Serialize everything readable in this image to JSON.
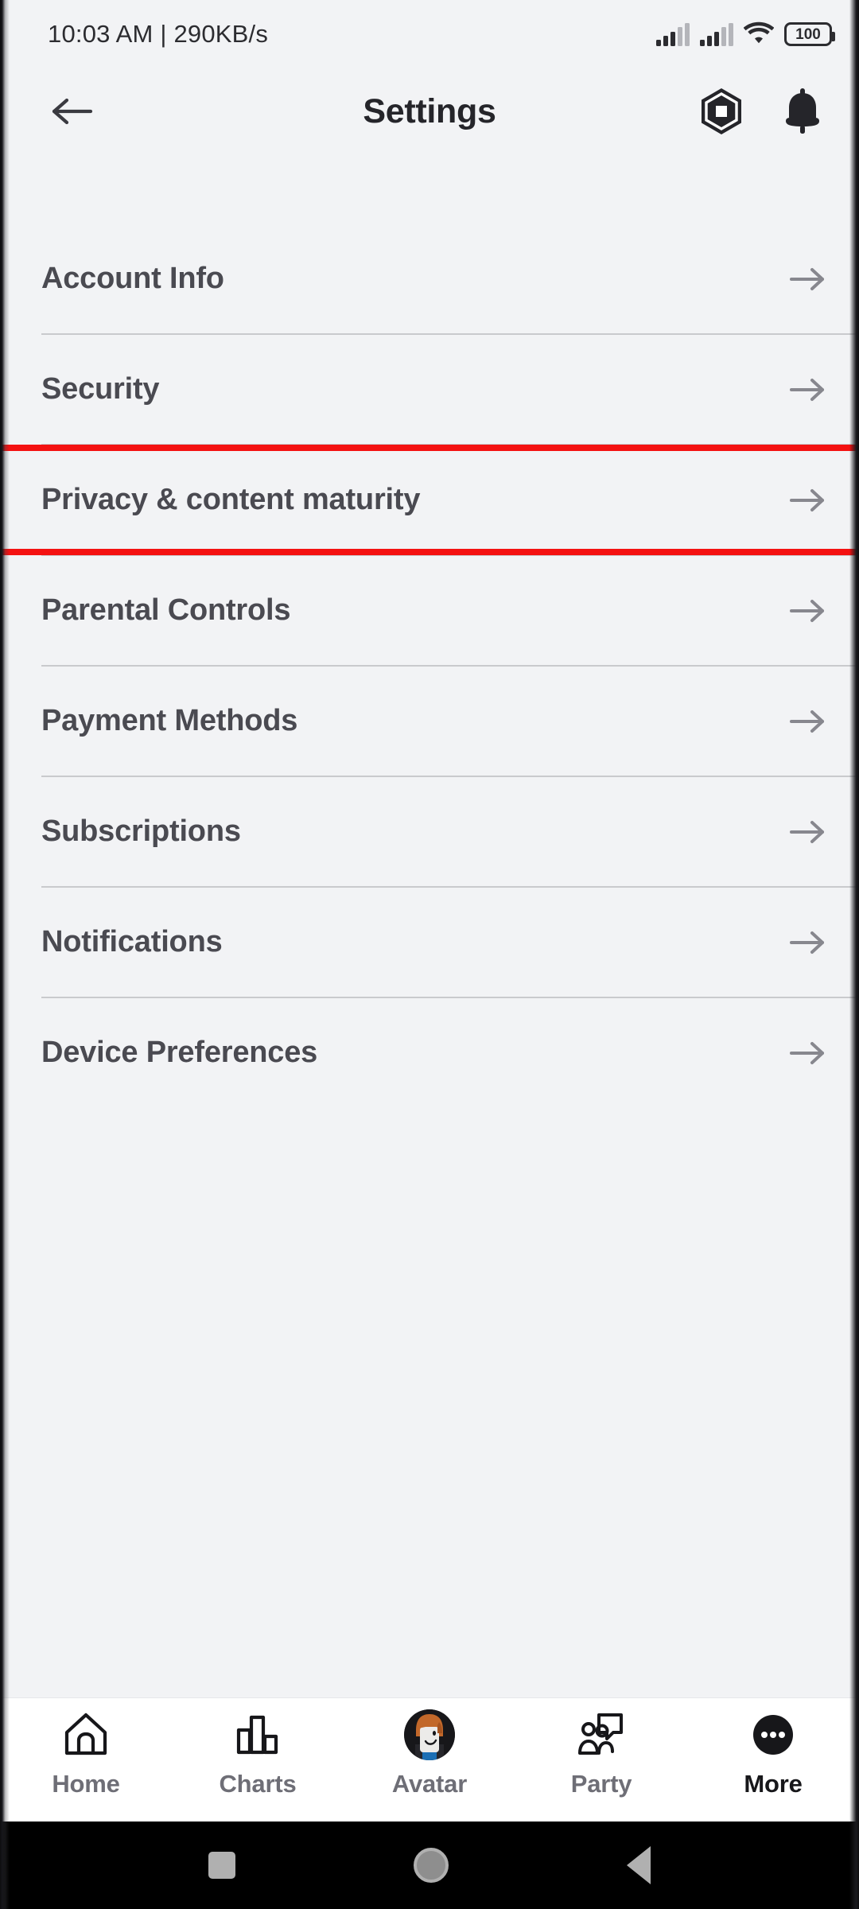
{
  "status_bar": {
    "time_and_network": "10:03 AM | 290KB/s",
    "signal_1": "signal-bars-icon",
    "signal_2": "signal-bars-icon",
    "wifi": "wifi-icon",
    "battery_level": "100"
  },
  "header": {
    "back": "back-arrow-icon",
    "title": "Settings",
    "robux": "robux-hexagon-icon",
    "notifications": "bell-icon"
  },
  "settings": {
    "items": [
      {
        "label": "Account Info",
        "highlighted": false
      },
      {
        "label": "Security",
        "highlighted": false
      },
      {
        "label": "Privacy & content maturity",
        "highlighted": true
      },
      {
        "label": "Parental Controls",
        "highlighted": false
      },
      {
        "label": "Payment Methods",
        "highlighted": false
      },
      {
        "label": "Subscriptions",
        "highlighted": false
      },
      {
        "label": "Notifications",
        "highlighted": false
      },
      {
        "label": "Device Preferences",
        "highlighted": false
      }
    ]
  },
  "tabbar": {
    "tabs": [
      {
        "label": "Home",
        "icon": "home-icon",
        "active": false
      },
      {
        "label": "Charts",
        "icon": "bar-chart-icon",
        "active": false
      },
      {
        "label": "Avatar",
        "icon": "avatar-image",
        "active": false
      },
      {
        "label": "Party",
        "icon": "party-icon",
        "active": false
      },
      {
        "label": "More",
        "icon": "more-dots-icon",
        "active": true
      }
    ]
  },
  "android_nav": {
    "recents": "square-recents-icon",
    "home": "circle-home-icon",
    "back": "triangle-back-icon"
  },
  "colors": {
    "page_background": "#f2f3f5",
    "highlight_red": "#f41111",
    "text_primary": "#4a4a51",
    "tabbar_background": "#ffffff"
  }
}
